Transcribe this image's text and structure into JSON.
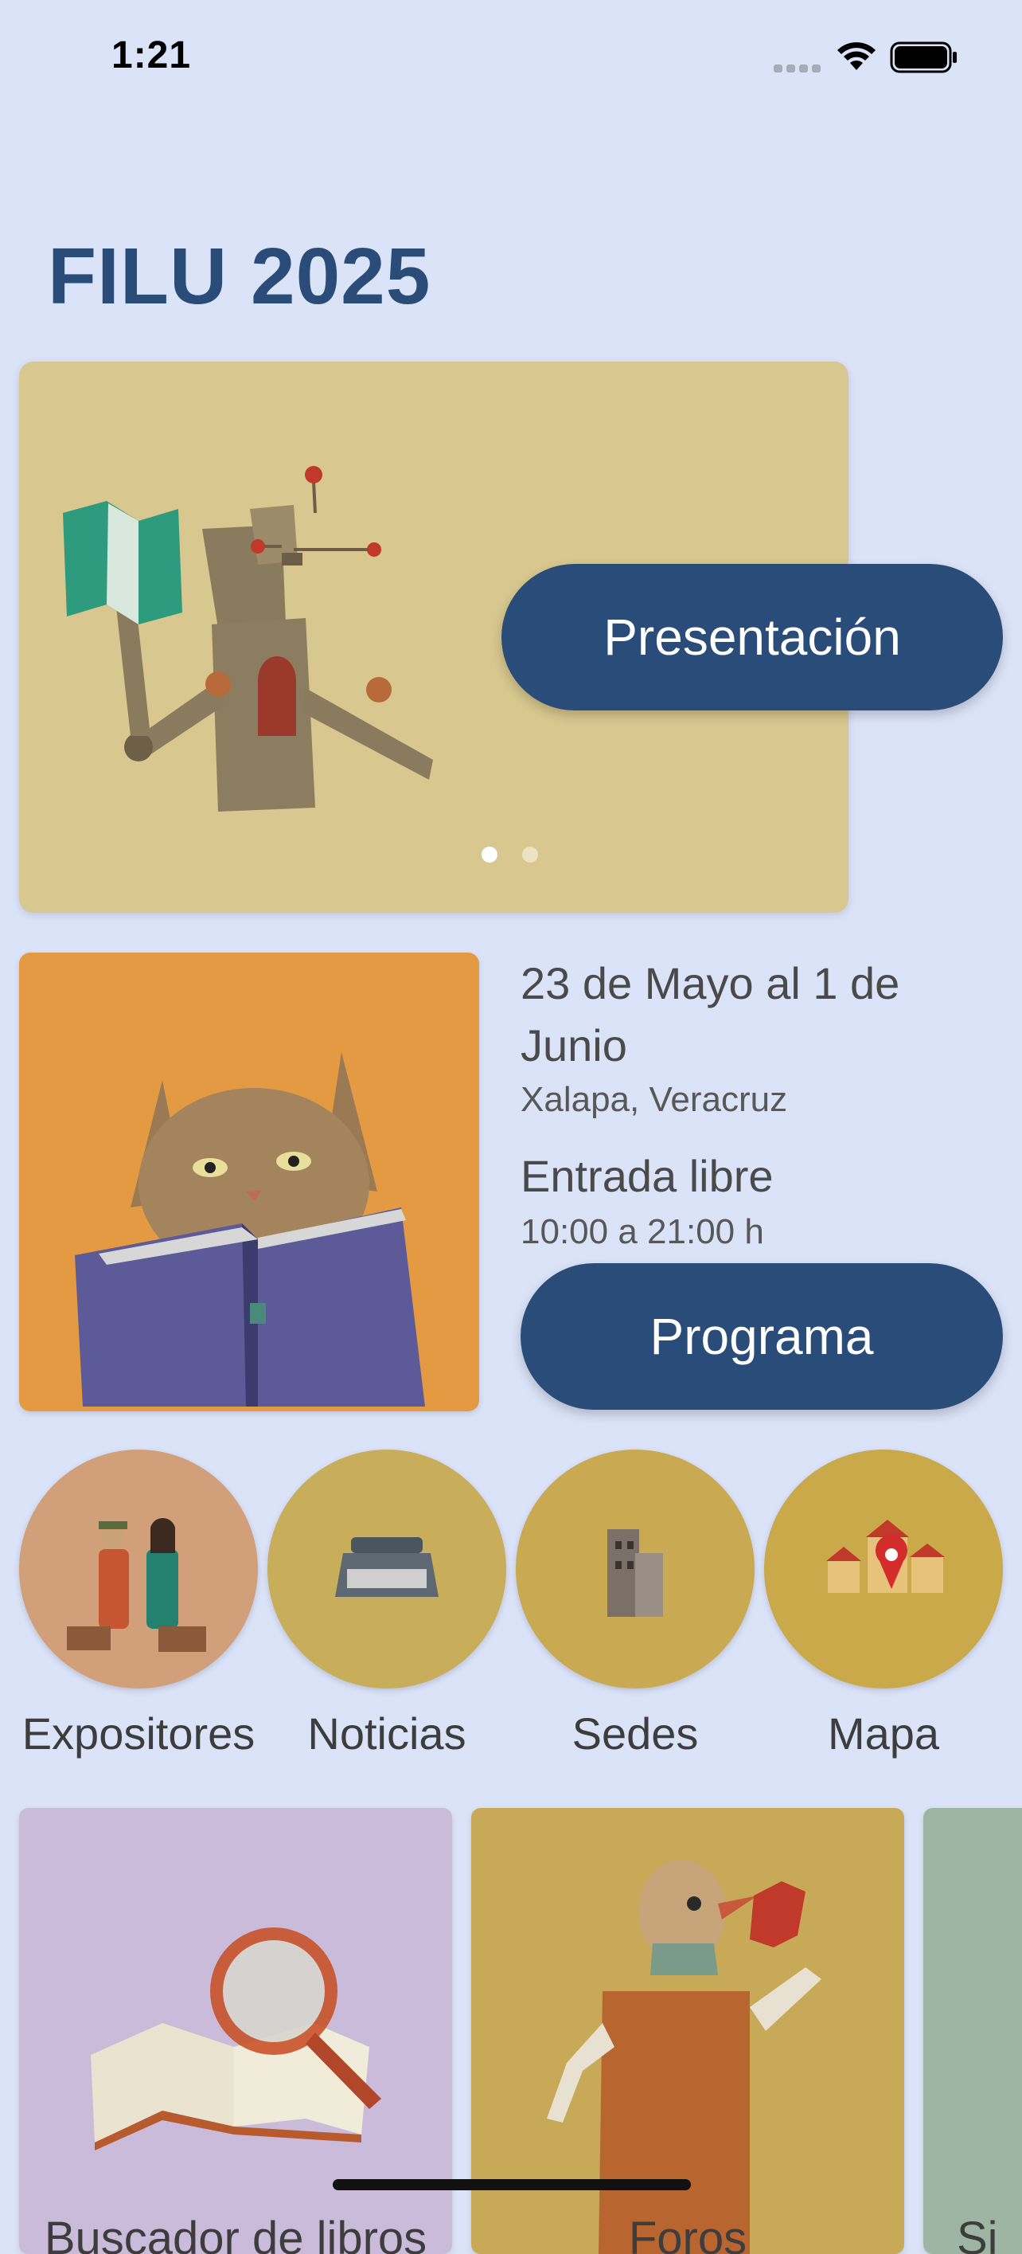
{
  "status_bar": {
    "time": "1:21"
  },
  "header": {
    "title": "FILU 2025"
  },
  "hero": {
    "button_label": "Presentación",
    "carousel_pages": 2,
    "carousel_active": 1
  },
  "info": {
    "dates": "23 de Mayo al 1 de Junio",
    "city": "Xalapa, Veracruz",
    "entry": "Entrada libre",
    "hours": "10:00 a 21:00 h",
    "button_label": "Programa"
  },
  "circles": [
    {
      "label": "Expositores",
      "icon": "exhibitors-icon",
      "color": "#d19f7a"
    },
    {
      "label": "Noticias",
      "icon": "typewriter-icon",
      "color": "#c8ad5a"
    },
    {
      "label": "Sedes",
      "icon": "building-icon",
      "color": "#c9aa52"
    },
    {
      "label": "Mapa",
      "icon": "map-pin-icon",
      "color": "#c9a949"
    }
  ],
  "cards": [
    {
      "label": "Buscador de libros",
      "icon": "magnifier-book-icon",
      "color": "#c9bbd9"
    },
    {
      "label": "Foros",
      "icon": "bird-reader-icon",
      "color": "#c7a957"
    },
    {
      "label": "Si",
      "icon": "partial-card-icon",
      "color": "#9fb5a3"
    }
  ],
  "colors": {
    "background": "#dbe3f9",
    "accent": "#2a4c79",
    "title": "#2a4c79"
  }
}
